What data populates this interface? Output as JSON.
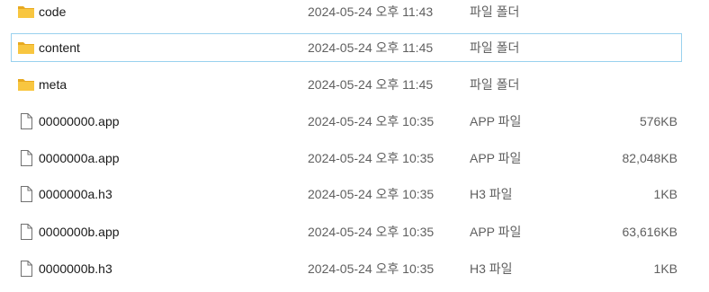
{
  "colors": {
    "folder_icon": "#f8c640",
    "folder_icon_dark": "#e8a920",
    "file_icon_outline": "#707070",
    "selection_border": "#99d1ee"
  },
  "files": [
    {
      "name": "code",
      "modified": "2024-05-24 오후 11:43",
      "type": "파일 폴더",
      "size": "",
      "icon": "folder-icon",
      "selected": false
    },
    {
      "name": "content",
      "modified": "2024-05-24 오후 11:45",
      "type": "파일 폴더",
      "size": "",
      "icon": "folder-icon",
      "selected": true
    },
    {
      "name": "meta",
      "modified": "2024-05-24 오후 11:45",
      "type": "파일 폴더",
      "size": "",
      "icon": "folder-icon",
      "selected": false
    },
    {
      "name": "00000000.app",
      "modified": "2024-05-24 오후 10:35",
      "type": "APP 파일",
      "size": "576KB",
      "icon": "file-icon",
      "selected": false
    },
    {
      "name": "0000000a.app",
      "modified": "2024-05-24 오후 10:35",
      "type": "APP 파일",
      "size": "82,048KB",
      "icon": "file-icon",
      "selected": false
    },
    {
      "name": "0000000a.h3",
      "modified": "2024-05-24 오후 10:35",
      "type": "H3 파일",
      "size": "1KB",
      "icon": "file-icon",
      "selected": false
    },
    {
      "name": "0000000b.app",
      "modified": "2024-05-24 오후 10:35",
      "type": "APP 파일",
      "size": "63,616KB",
      "icon": "file-icon",
      "selected": false
    },
    {
      "name": "0000000b.h3",
      "modified": "2024-05-24 오후 10:35",
      "type": "H3 파일",
      "size": "1KB",
      "icon": "file-icon",
      "selected": false
    }
  ]
}
